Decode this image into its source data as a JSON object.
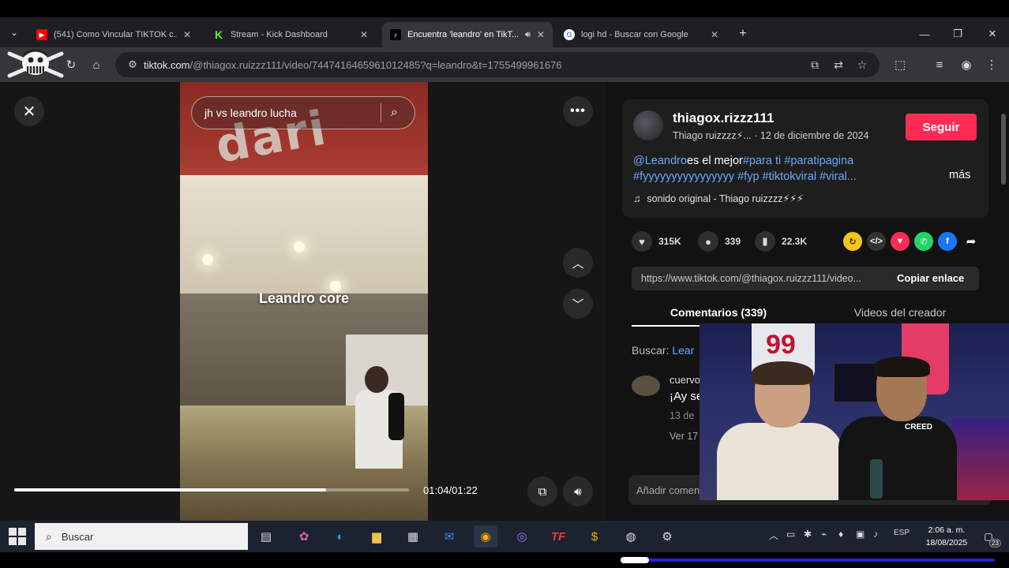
{
  "browser": {
    "tabs": [
      {
        "title": "(541) Como Vincular TIKTOK c...",
        "favicon_color": "#ff0000",
        "favicon": "youtube-icon",
        "active": false
      },
      {
        "title": "Stream - Kick Dashboard",
        "favicon_color": "#53fc18",
        "favicon": "kick-icon",
        "active": false
      },
      {
        "title": "Encuentra 'leandro' en TikT...",
        "favicon_color": "#ffffff",
        "favicon": "tiktok-icon",
        "active": true,
        "audio": true
      },
      {
        "title": "logi hd - Buscar con Google",
        "favicon_color": "#4285f4",
        "favicon": "google-icon",
        "active": false
      }
    ],
    "url_host": "tiktok.com",
    "url_path": "/@thiagox.ruizzz111/video/7447416465961012485?q=leandro&t=1755499961676"
  },
  "video": {
    "search_query": "jh vs leandro lucha",
    "sign_text": "dari",
    "caption": "Leandro core",
    "current_time": "01:04",
    "duration": "01:22",
    "time_text": "01:04/01:22",
    "progress_fraction": 0.79
  },
  "post": {
    "username": "thiagox.rizzz111",
    "display_name": "Thiago ruizzzz⚡...",
    "date": "· 12 de diciembre de 2024",
    "follow_label": "Seguir",
    "desc_mention": "@Leandro",
    "desc_text1": "es el mejor",
    "desc_tags1": "#para ti #paratipagina",
    "desc_tags2": "#fyyyyyyyyyyyyyyyy #fyp #tiktokviral #viral...",
    "more_label": "más",
    "sound": "sonido original - Thiago ruizzzz⚡⚡⚡",
    "likes": "315K",
    "comments": "339",
    "saves": "22.3K",
    "share_link": "https://www.tiktok.com/@thiagox.ruizzz111/video...",
    "copy_label": "Copiar enlace",
    "tab_comments": "Comentarios (339)",
    "tab_creator": "Videos del creador",
    "search_label": "Buscar:",
    "search_highlight": "Lear",
    "comment_name": "cuervo",
    "comment_text": "¡Ay se",
    "comment_date": "13 de",
    "comment_replies": "Ver 17",
    "comment_placeholder": "Añadir comen"
  },
  "webcam": {
    "jersey_number": "99",
    "shirt_text": "CREED"
  },
  "taskbar": {
    "search_label": "Buscar",
    "lang": "ESP",
    "time": "2:06 a. m.",
    "date": "18/08/2025",
    "notifications": "23"
  },
  "colors": {
    "accent": "#fe2c55",
    "hashtag": "#6aa8ff",
    "stream_line": "#1a26d8"
  }
}
